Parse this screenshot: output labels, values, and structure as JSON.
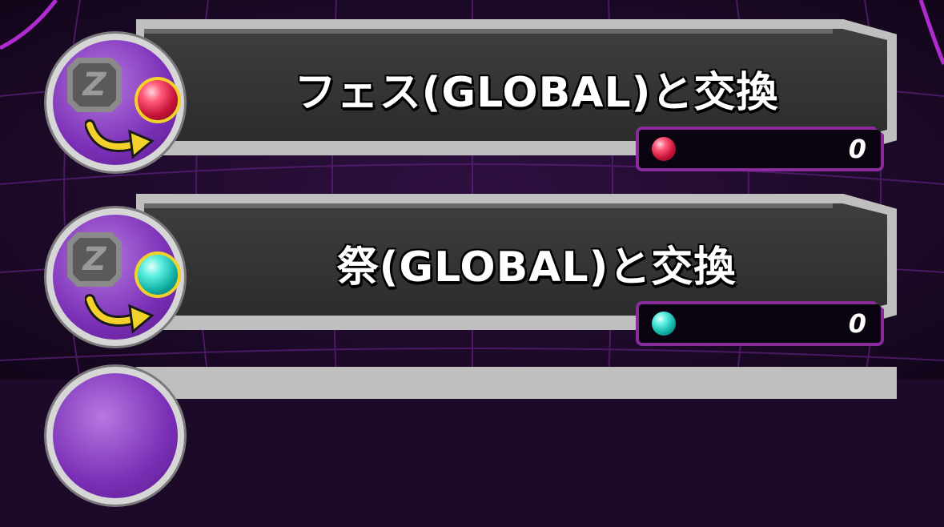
{
  "exchange_list": {
    "items": [
      {
        "title": "フェス(GLOBAL)と交換",
        "count": "0",
        "medal_icon": "fes-medal-icon",
        "medal_color": "#d81e46"
      },
      {
        "title": "祭(GLOBAL)と交換",
        "count": "0",
        "medal_icon": "festival-medal-icon",
        "medal_color": "#1cc4b6"
      }
    ]
  },
  "colors": {
    "background": "#1c0a28",
    "grid_line": "#5a1f78",
    "counter_border": "#8a2b9c",
    "medallion_purple": "#7a2fb6",
    "arrow_yellow": "#f2d22a"
  }
}
